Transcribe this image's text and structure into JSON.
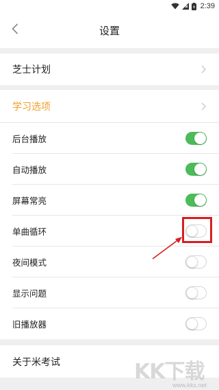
{
  "status_bar": {
    "time": "2:39",
    "icons": [
      "wifi-icon",
      "signal-icon",
      "battery-icon"
    ]
  },
  "header": {
    "title": "设置",
    "back_icon": "chevron-left-icon"
  },
  "plan": {
    "label": "芝士计划"
  },
  "study": {
    "label": "学习选项",
    "accent_color": "#f0a02a",
    "items": [
      {
        "label": "后台播放",
        "enabled": true
      },
      {
        "label": "自动播放",
        "enabled": true
      },
      {
        "label": "屏幕常亮",
        "enabled": true
      },
      {
        "label": "单曲循环",
        "enabled": false
      },
      {
        "label": "夜间模式",
        "enabled": false
      },
      {
        "label": "显示问题",
        "enabled": false
      },
      {
        "label": "旧播放器",
        "enabled": false
      }
    ]
  },
  "about": {
    "label": "关于米考试"
  },
  "colors": {
    "toggle_on": "#4cbb59",
    "annotation_red": "#d81e1e"
  },
  "watermark": {
    "text": "KK下载",
    "url": "www.kkx.net"
  }
}
